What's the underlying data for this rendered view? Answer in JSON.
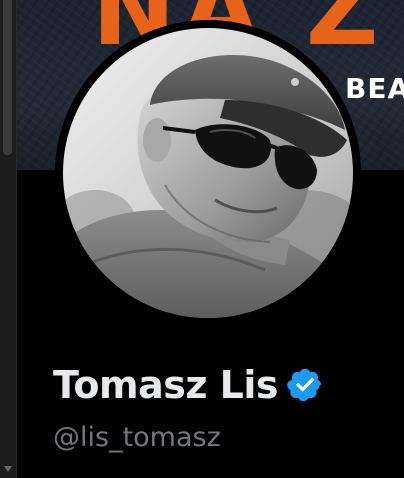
{
  "banner": {
    "headline_fragment": "NA Z",
    "subline_fragment": "BEA"
  },
  "profile": {
    "display_name": "Tomasz Lis",
    "handle": "@lis_tomasz",
    "verified": true,
    "avatar_icon": "profile-photo",
    "badge_icon": "verified-badge-icon"
  },
  "colors": {
    "background": "#000000",
    "name_text": "#e7e9ea",
    "handle_text": "#71767b",
    "verified_blue": "#1d9bf0",
    "banner_accent": "#e8631a"
  }
}
